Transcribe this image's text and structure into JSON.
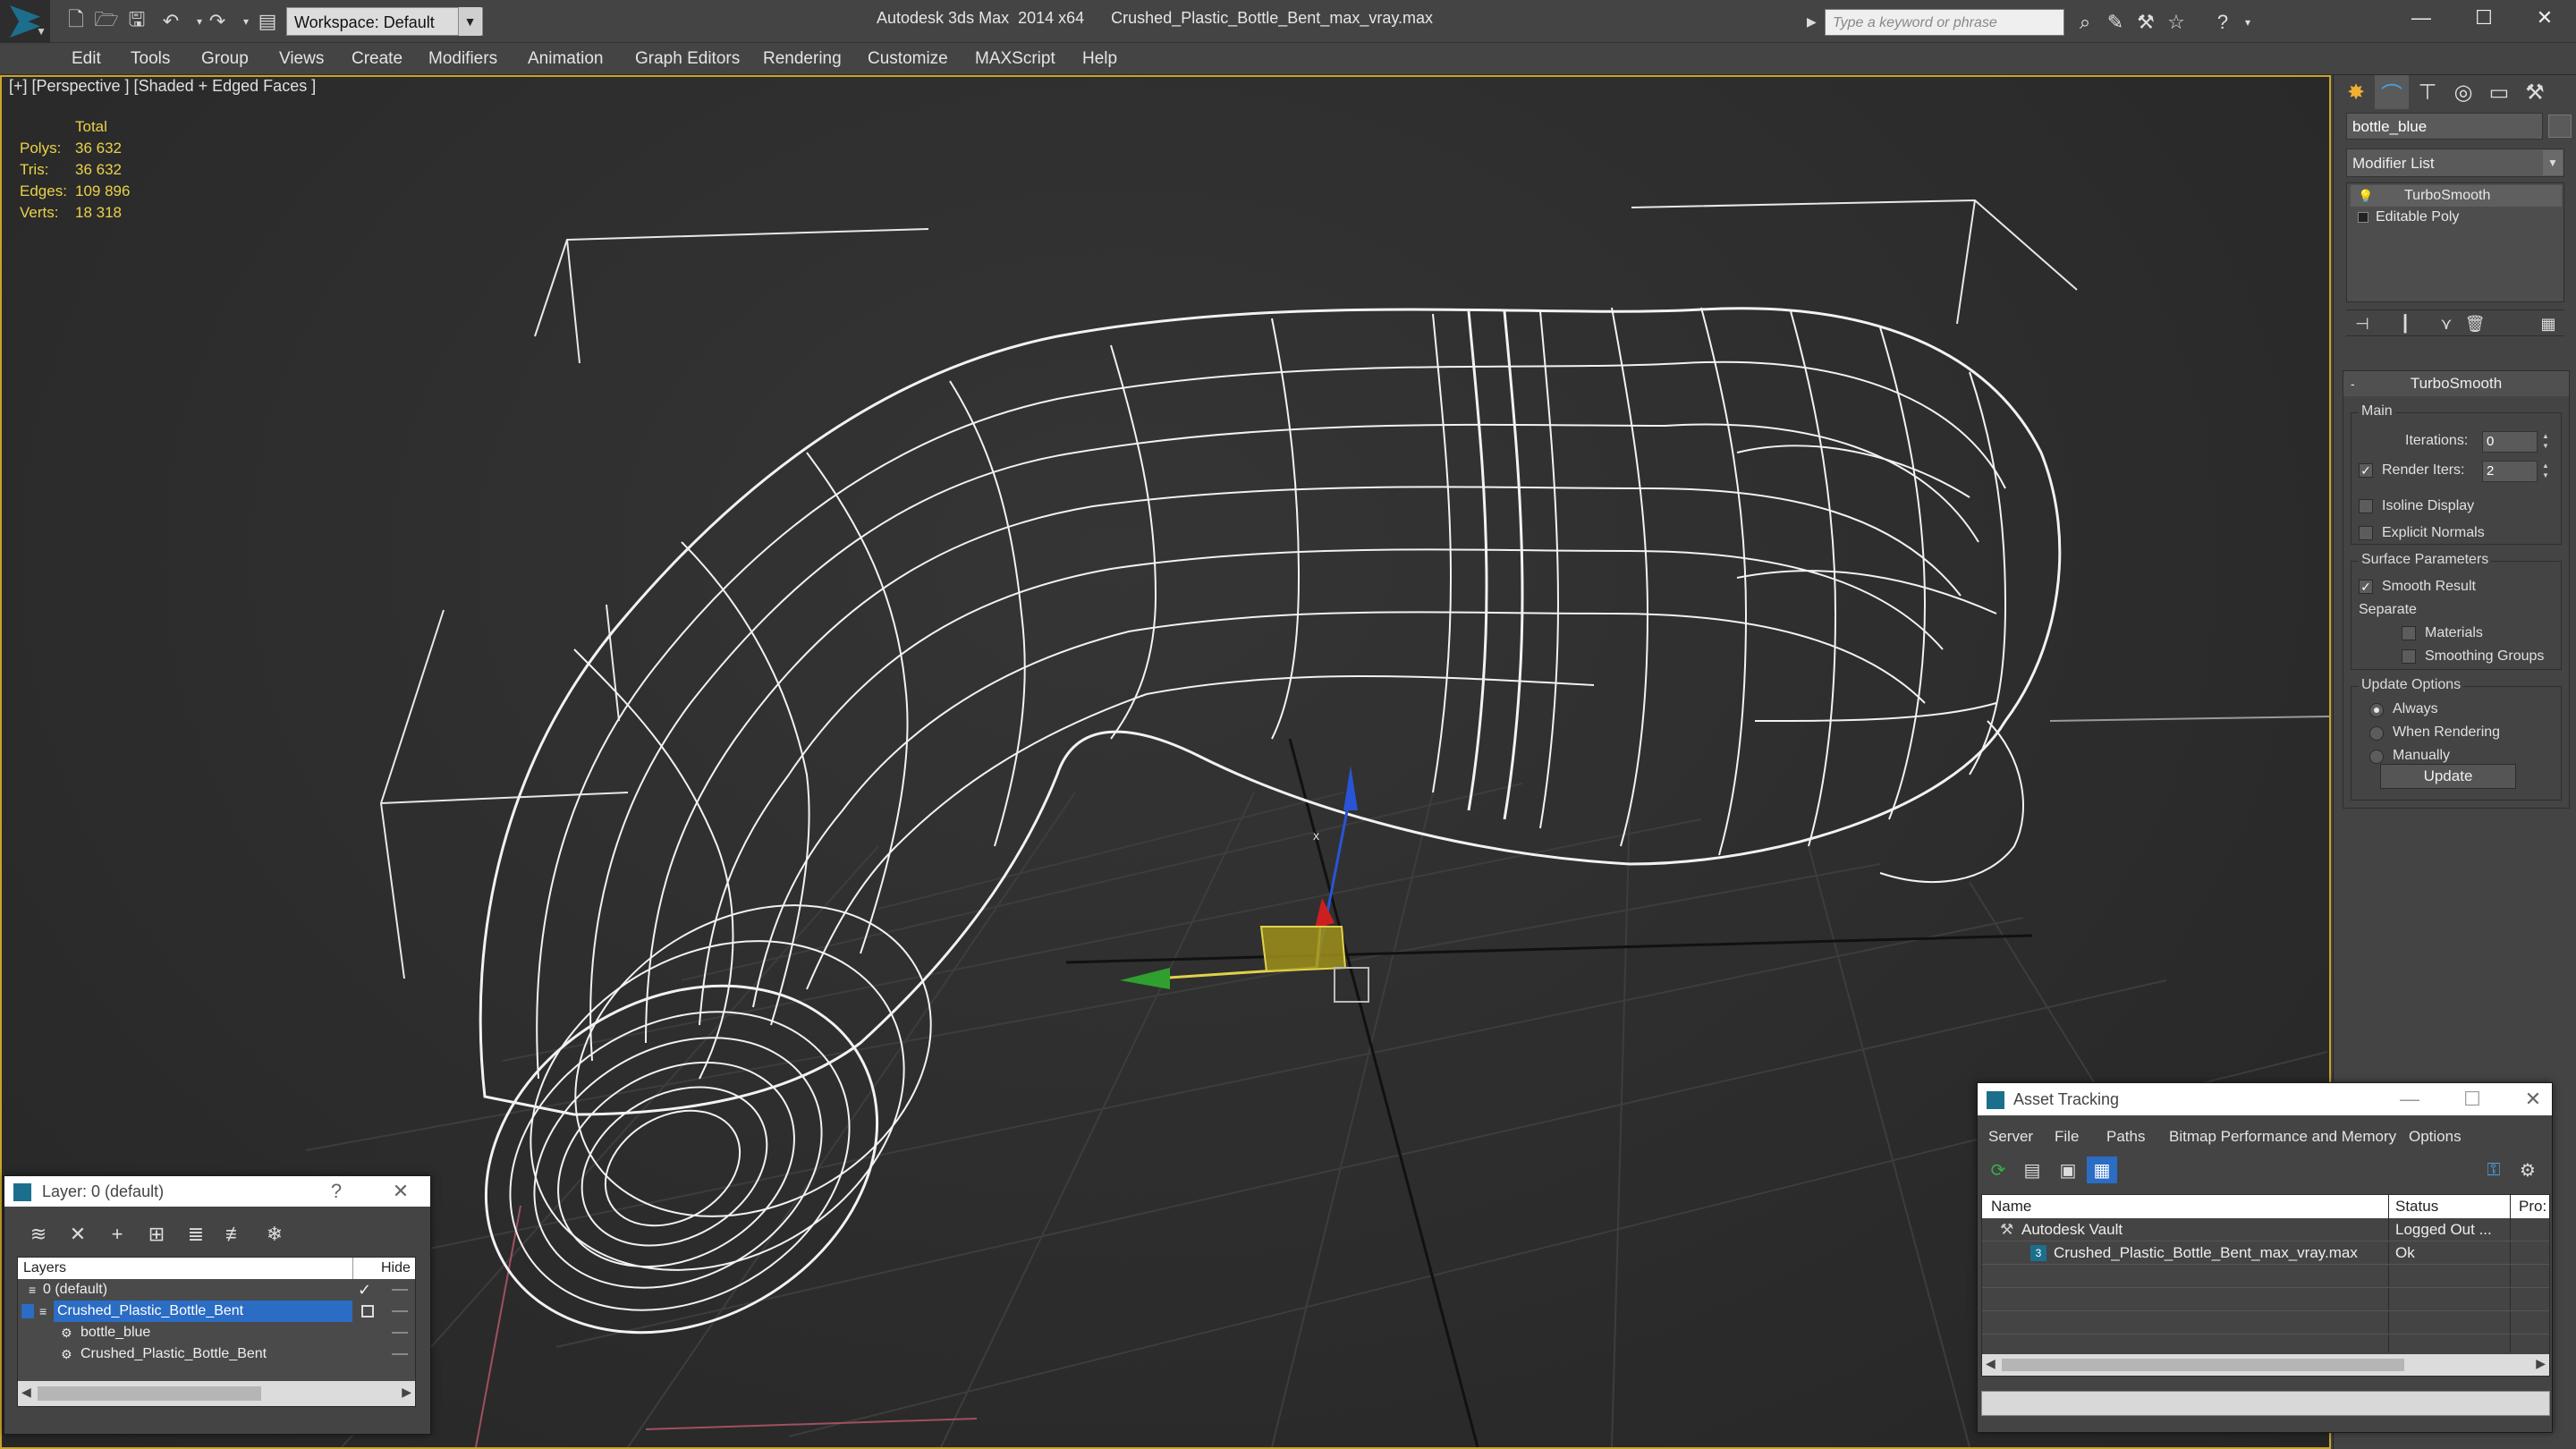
{
  "titlebar": {
    "app_title": "Autodesk 3ds Max  2014 x64",
    "file_title": "Crushed_Plastic_Bottle_Bent_max_vray.max",
    "workspace_label": "Workspace: Default",
    "search_placeholder": "Type a keyword or phrase"
  },
  "menu": [
    "Edit",
    "Tools",
    "Group",
    "Views",
    "Create",
    "Modifiers",
    "Animation",
    "Graph Editors",
    "Rendering",
    "Customize",
    "MAXScript",
    "Help"
  ],
  "viewport": {
    "label": "[+] [Perspective ] [Shaded + Edged Faces ]",
    "stats": {
      "header": "Total",
      "rows": [
        {
          "key": "Polys:",
          "value": "36 632"
        },
        {
          "key": "Tris:",
          "value": "36 632"
        },
        {
          "key": "Edges:",
          "value": "109 896"
        },
        {
          "key": "Verts:",
          "value": "18 318"
        }
      ]
    },
    "gizmo_axis_label": "x"
  },
  "command_panel": {
    "object_name": "bottle_blue",
    "modifier_list": "Modifier List",
    "stack": [
      "TurboSmooth",
      "Editable Poly"
    ],
    "rollout_title": "TurboSmooth",
    "main_group": "Main",
    "iterations_label": "Iterations:",
    "iterations_value": "0",
    "render_iters_label": "Render Iters:",
    "render_iters_value": "2",
    "render_iters_checked": true,
    "isoline_label": "Isoline Display",
    "explicit_normals_label": "Explicit Normals",
    "surface_group": "Surface Parameters",
    "smooth_result_label": "Smooth Result",
    "smooth_result_checked": true,
    "separate_label": "Separate",
    "materials_label": "Materials",
    "smoothing_groups_label": "Smoothing Groups",
    "update_group": "Update Options",
    "update_options": [
      "Always",
      "When Rendering",
      "Manually"
    ],
    "update_selected": 0,
    "update_button": "Update"
  },
  "layer_dialog": {
    "title": "Layer: 0 (default)",
    "help": "?",
    "col_layers": "Layers",
    "col_hide": "Hide",
    "rows": [
      {
        "name": "0 (default)",
        "active": true
      },
      {
        "name": "Crushed_Plastic_Bottle_Bent",
        "selected": true
      },
      {
        "name": "bottle_blue"
      },
      {
        "name": "Crushed_Plastic_Bottle_Bent"
      }
    ]
  },
  "asset_dialog": {
    "title": "Asset Tracking",
    "menu": [
      "Server",
      "File",
      "Paths",
      "Bitmap Performance and Memory",
      "Options"
    ],
    "col_name": "Name",
    "col_status": "Status",
    "col_pro": "Pro:",
    "rows": [
      {
        "name": "Autodesk Vault",
        "status": "Logged Out ..."
      },
      {
        "name": "Crushed_Plastic_Bottle_Bent_max_vray.max",
        "status": "Ok"
      }
    ]
  },
  "colors": {
    "ui_background": "#444444",
    "viewport_border": "#c9a42a",
    "stats_text": "#e9d24a",
    "selection_blue": "#2b6cc4",
    "wireframe": "#ffffff"
  }
}
